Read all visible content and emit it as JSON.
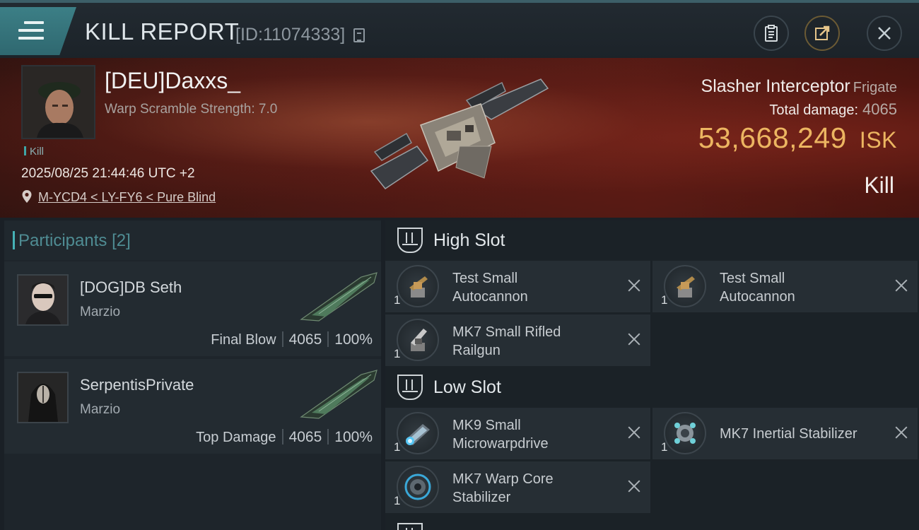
{
  "header": {
    "title": "KILL REPORT",
    "report_id": "[ID:11074333]"
  },
  "victim": {
    "name": "[DEU]Daxxs_",
    "subtitle": "Warp Scramble Strength: 7.0",
    "tag": "Kill",
    "timestamp": "2025/08/25 21:44:46 UTC +2",
    "location": "M-YCD4 < LY-FY6 < Pure Blind"
  },
  "ship": {
    "name": "Slasher Interceptor",
    "class": "Frigate",
    "total_damage_label": "Total damage:",
    "total_damage": "4065",
    "isk_value": "53,668,249",
    "isk_unit": "ISK",
    "result_label": "Kill"
  },
  "participants": {
    "title": "Participants",
    "count": "[2]",
    "items": [
      {
        "name": "[DOG]DB Seth",
        "corp": "Marzio",
        "role": "Final Blow",
        "damage": "4065",
        "percent": "100%"
      },
      {
        "name": "SerpentisPrivate",
        "corp": "Marzio",
        "role": "Top Damage",
        "damage": "4065",
        "percent": "100%"
      }
    ]
  },
  "fitting": {
    "high_slot": {
      "title": "High Slot",
      "modules": [
        {
          "line1": "Test Small",
          "line2": "Autocannon",
          "qty": "1",
          "icon": "autocannon-icon"
        },
        {
          "line1": "Test Small",
          "line2": "Autocannon",
          "qty": "1",
          "icon": "autocannon-icon"
        },
        {
          "line1": "MK7 Small Rifled",
          "line2": "Railgun",
          "qty": "1",
          "icon": "railgun-icon"
        }
      ]
    },
    "low_slot": {
      "title": "Low Slot",
      "modules": [
        {
          "line1": "MK9 Small",
          "line2": "Microwarpdrive",
          "qty": "1",
          "icon": "microwarpdrive-icon"
        },
        {
          "line1": "MK7 Inertial Stabilizer",
          "line2": "",
          "qty": "1",
          "icon": "inertial-stabilizer-icon"
        },
        {
          "line1": "MK7 Warp Core",
          "line2": "Stabilizer",
          "qty": "1",
          "icon": "warp-core-stabilizer-icon"
        }
      ]
    }
  },
  "colors": {
    "accent_teal": "#3c7f86",
    "isk_gold": "#ecb561",
    "banner_red": "#5a211b"
  }
}
